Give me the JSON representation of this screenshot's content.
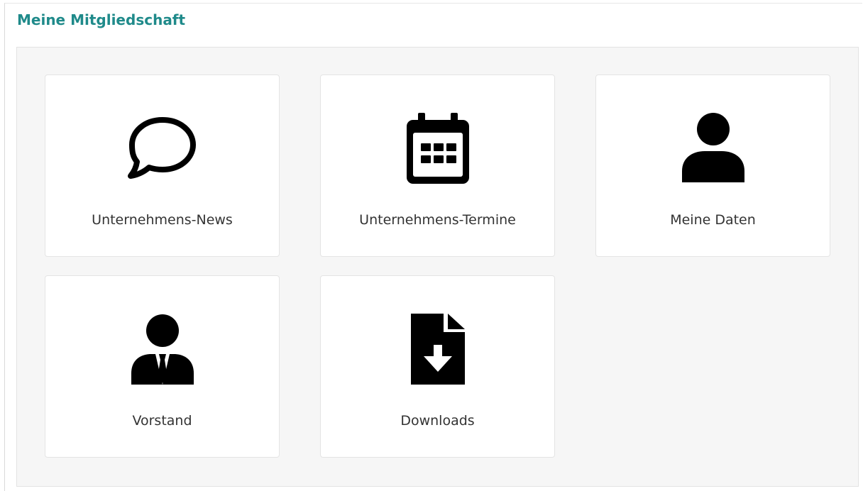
{
  "header": {
    "title": "Meine Mitgliedschaft"
  },
  "accent_color": "#1f8a8a",
  "tiles": [
    {
      "label": "Unternehmens-News",
      "icon": "speech-bubble-icon"
    },
    {
      "label": "Unternehmens-Termine",
      "icon": "calendar-icon"
    },
    {
      "label": "Meine Daten",
      "icon": "user-icon"
    },
    {
      "label": "Vorstand",
      "icon": "user-tie-icon"
    },
    {
      "label": "Downloads",
      "icon": "file-download-icon"
    }
  ]
}
